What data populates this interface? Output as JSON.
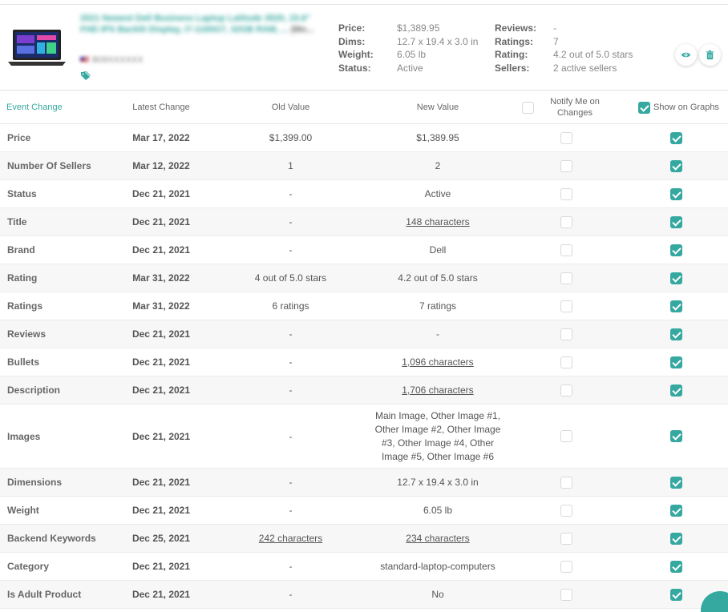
{
  "product": {
    "title": "2021 Newest Dell Business Laptop Latitude 3520, 15.6\" FHD IPS Backlit Display, i7-1165G7, 32GB RAM, ...",
    "title_tail": "(Mo...",
    "asin": "B09XXXXXX",
    "image_icon": "laptop-thumbnail",
    "tag_icon": "tag-icon",
    "specs_left": [
      {
        "label": "Price:",
        "value": "$1,389.95"
      },
      {
        "label": "Dims:",
        "value": "12.7 x 19.4 x 3.0 in"
      },
      {
        "label": "Weight:",
        "value": "6.05 lb"
      },
      {
        "label": "Status:",
        "value": "Active"
      }
    ],
    "specs_right": [
      {
        "label": "Reviews:",
        "value": "-"
      },
      {
        "label": "Ratings:",
        "value": "7"
      },
      {
        "label": "Rating:",
        "value": "4.2 out of 5.0 stars"
      },
      {
        "label": "Sellers:",
        "value": "2 active sellers"
      }
    ]
  },
  "columns": {
    "event": "Event Change",
    "latest": "Latest Change",
    "old": "Old Value",
    "new": "New Value",
    "notify": "Notify Me on Changes",
    "graphs": "Show on Graphs"
  },
  "rows": [
    {
      "event": "Price",
      "latest": "Mar 17, 2022",
      "old": "$1,399.00",
      "new": "$1,389.95"
    },
    {
      "event": "Number Of Sellers",
      "latest": "Mar 12, 2022",
      "old": "1",
      "new": "2"
    },
    {
      "event": "Status",
      "latest": "Dec 21, 2021",
      "old": "-",
      "new": "Active"
    },
    {
      "event": "Title",
      "latest": "Dec 21, 2021",
      "old": "-",
      "new": "148 characters"
    },
    {
      "event": "Brand",
      "latest": "Dec 21, 2021",
      "old": "-",
      "new": "Dell"
    },
    {
      "event": "Rating",
      "latest": "Mar 31, 2022",
      "old": "4 out of 5.0 stars",
      "new": "4.2 out of 5.0 stars"
    },
    {
      "event": "Ratings",
      "latest": "Mar 31, 2022",
      "old": "6 ratings",
      "new": "7 ratings"
    },
    {
      "event": "Reviews",
      "latest": "Dec 21, 2021",
      "old": "-",
      "new": "-"
    },
    {
      "event": "Bullets",
      "latest": "Dec 21, 2021",
      "old": "-",
      "new": "1,096 characters"
    },
    {
      "event": "Description",
      "latest": "Dec 21, 2021",
      "old": "-",
      "new": "1,706 characters"
    },
    {
      "event": "Images",
      "latest": "Dec 21, 2021",
      "old": "-",
      "new": "Main Image, Other Image #1, Other Image #2, Other Image #3, Other Image #4, Other Image #5, Other Image #6"
    },
    {
      "event": "Dimensions",
      "latest": "Dec 21, 2021",
      "old": "-",
      "new": "12.7 x 19.4 x 3.0 in"
    },
    {
      "event": "Weight",
      "latest": "Dec 21, 2021",
      "old": "-",
      "new": "6.05 lb"
    },
    {
      "event": "Backend Keywords",
      "latest": "Dec 25, 2021",
      "old": "242 characters",
      "new": "234 characters"
    },
    {
      "event": "Category",
      "latest": "Dec 21, 2021",
      "old": "-",
      "new": "standard-laptop-computers"
    },
    {
      "event": "Is Adult Product",
      "latest": "Dec 21, 2021",
      "old": "-",
      "new": "No"
    }
  ],
  "colors": {
    "accent": "#35a8a0",
    "text": "#555555",
    "muted": "#888888"
  }
}
